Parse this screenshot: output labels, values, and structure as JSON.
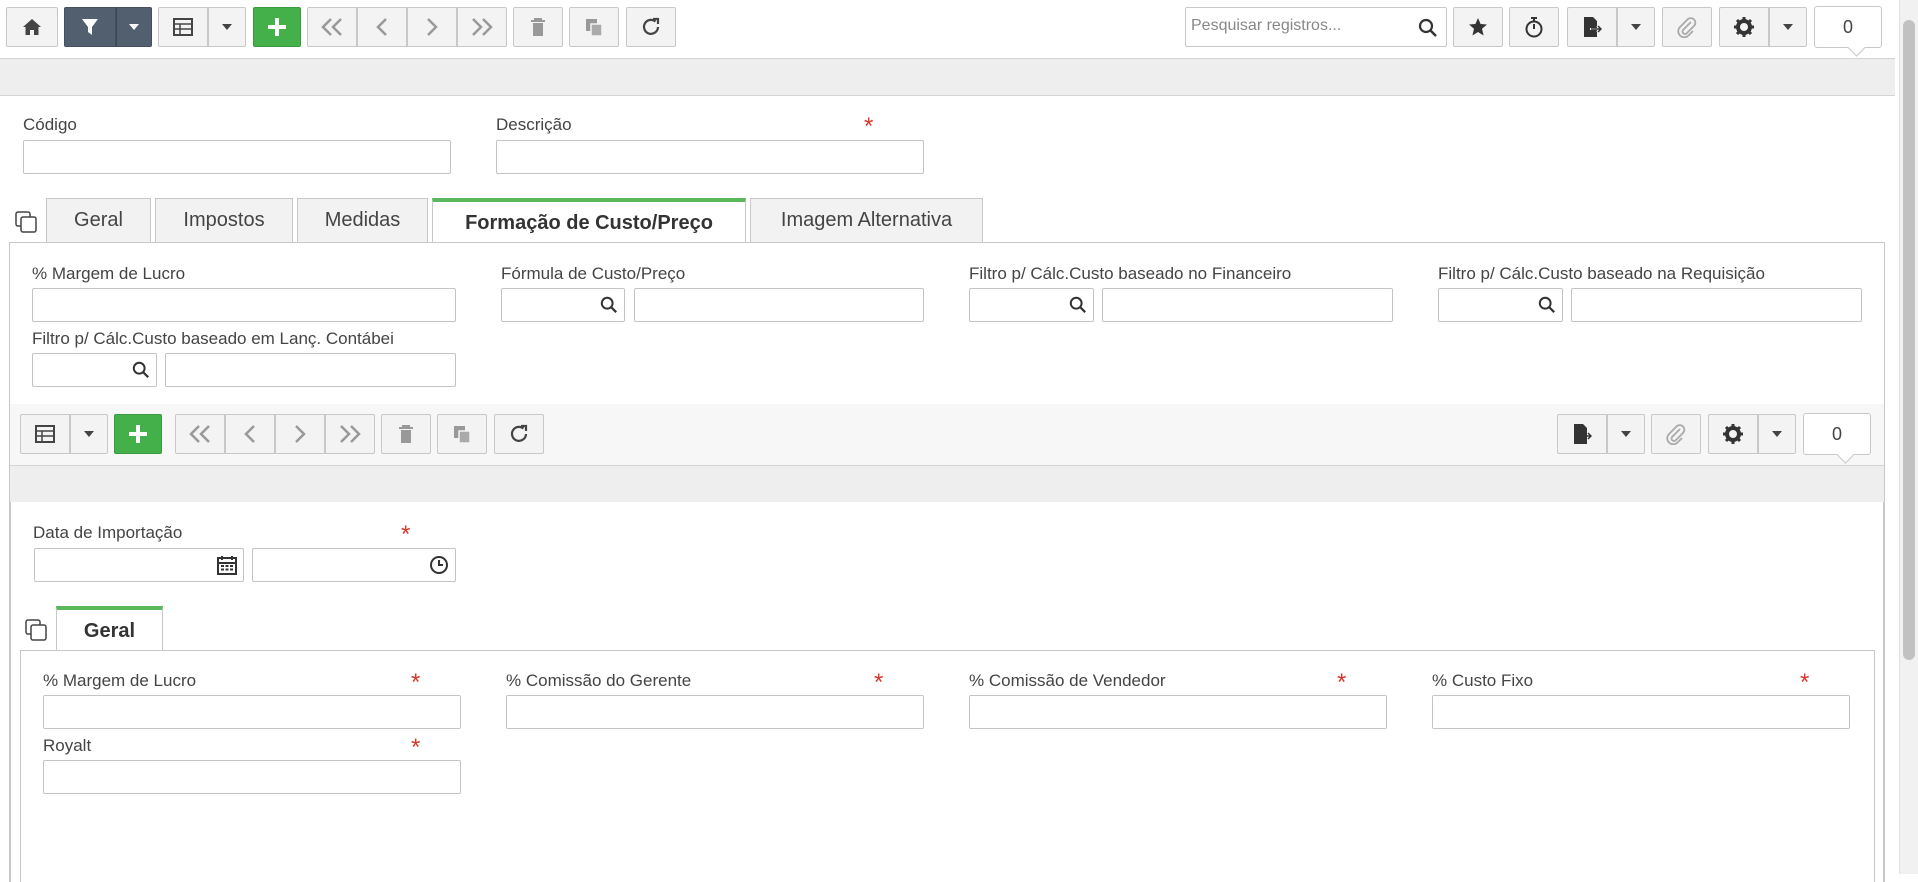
{
  "toolbar": {
    "search_placeholder": "Pesquisar registros...",
    "record_count": "0"
  },
  "header_fields": {
    "codigo_label": "Código",
    "descricao_label": "Descrição",
    "required_mark": "*"
  },
  "tabs": [
    {
      "label": "Geral",
      "active": false
    },
    {
      "label": "Impostos",
      "active": false
    },
    {
      "label": "Medidas",
      "active": false
    },
    {
      "label": "Formação de Custo/Preço",
      "active": true
    },
    {
      "label": "Imagem Alternativa",
      "active": false
    }
  ],
  "cost_tab": {
    "margem_label": "% Margem de Lucro",
    "formula_label": "Fórmula de Custo/Preço",
    "filtro_financeiro_label": "Filtro p/ Cálc.Custo baseado no Financeiro",
    "filtro_requisicao_label": "Filtro p/ Cálc.Custo baseado na Requisição",
    "filtro_contabil_label": "Filtro p/ Cálc.Custo baseado em Lanç. Contábei"
  },
  "sub_toolbar": {
    "record_count": "0"
  },
  "detail": {
    "data_importacao_label": "Data de Importação",
    "subtabs": [
      {
        "label": "Geral",
        "active": true
      }
    ],
    "margem_label": "% Margem de Lucro",
    "comissao_gerente_label": "% Comissão do Gerente",
    "comissao_vendedor_label": "% Comissão de Vendedor",
    "custo_fixo_label": "% Custo Fixo",
    "royalt_label": "Royalt"
  },
  "colors": {
    "accent_green": "#43b049",
    "active_tab_border": "#5cb85c",
    "filter_button": "#525f6e",
    "required": "#d9362b"
  }
}
